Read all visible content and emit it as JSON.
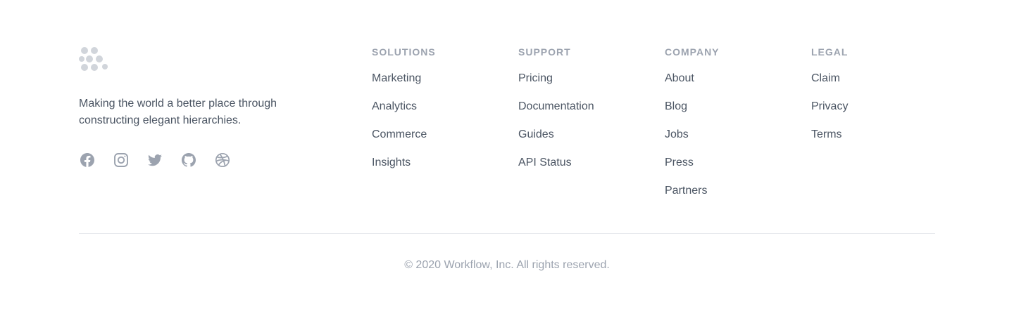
{
  "brand": {
    "logo_icon": "workflow-logo-icon",
    "tagline": "Making the world a better place through constructing elegant hierarchies."
  },
  "social": [
    {
      "name": "Facebook",
      "icon": "facebook-icon"
    },
    {
      "name": "Instagram",
      "icon": "instagram-icon"
    },
    {
      "name": "Twitter",
      "icon": "twitter-icon"
    },
    {
      "name": "GitHub",
      "icon": "github-icon"
    },
    {
      "name": "Dribbble",
      "icon": "dribbble-icon"
    }
  ],
  "columns": [
    {
      "heading": "SOLUTIONS",
      "links": [
        "Marketing",
        "Analytics",
        "Commerce",
        "Insights"
      ]
    },
    {
      "heading": "SUPPORT",
      "links": [
        "Pricing",
        "Documentation",
        "Guides",
        "API Status"
      ]
    },
    {
      "heading": "COMPANY",
      "links": [
        "About",
        "Blog",
        "Jobs",
        "Press",
        "Partners"
      ]
    },
    {
      "heading": "LEGAL",
      "links": [
        "Claim",
        "Privacy",
        "Terms"
      ]
    }
  ],
  "copyright": "© 2020 Workflow, Inc. All rights reserved.",
  "colors": {
    "background": "#ffffff",
    "heading": "#9ca3af",
    "link": "#4b5563",
    "icon": "#9ca3af",
    "logo": "#d1d5db",
    "divider": "#e5e7eb"
  }
}
